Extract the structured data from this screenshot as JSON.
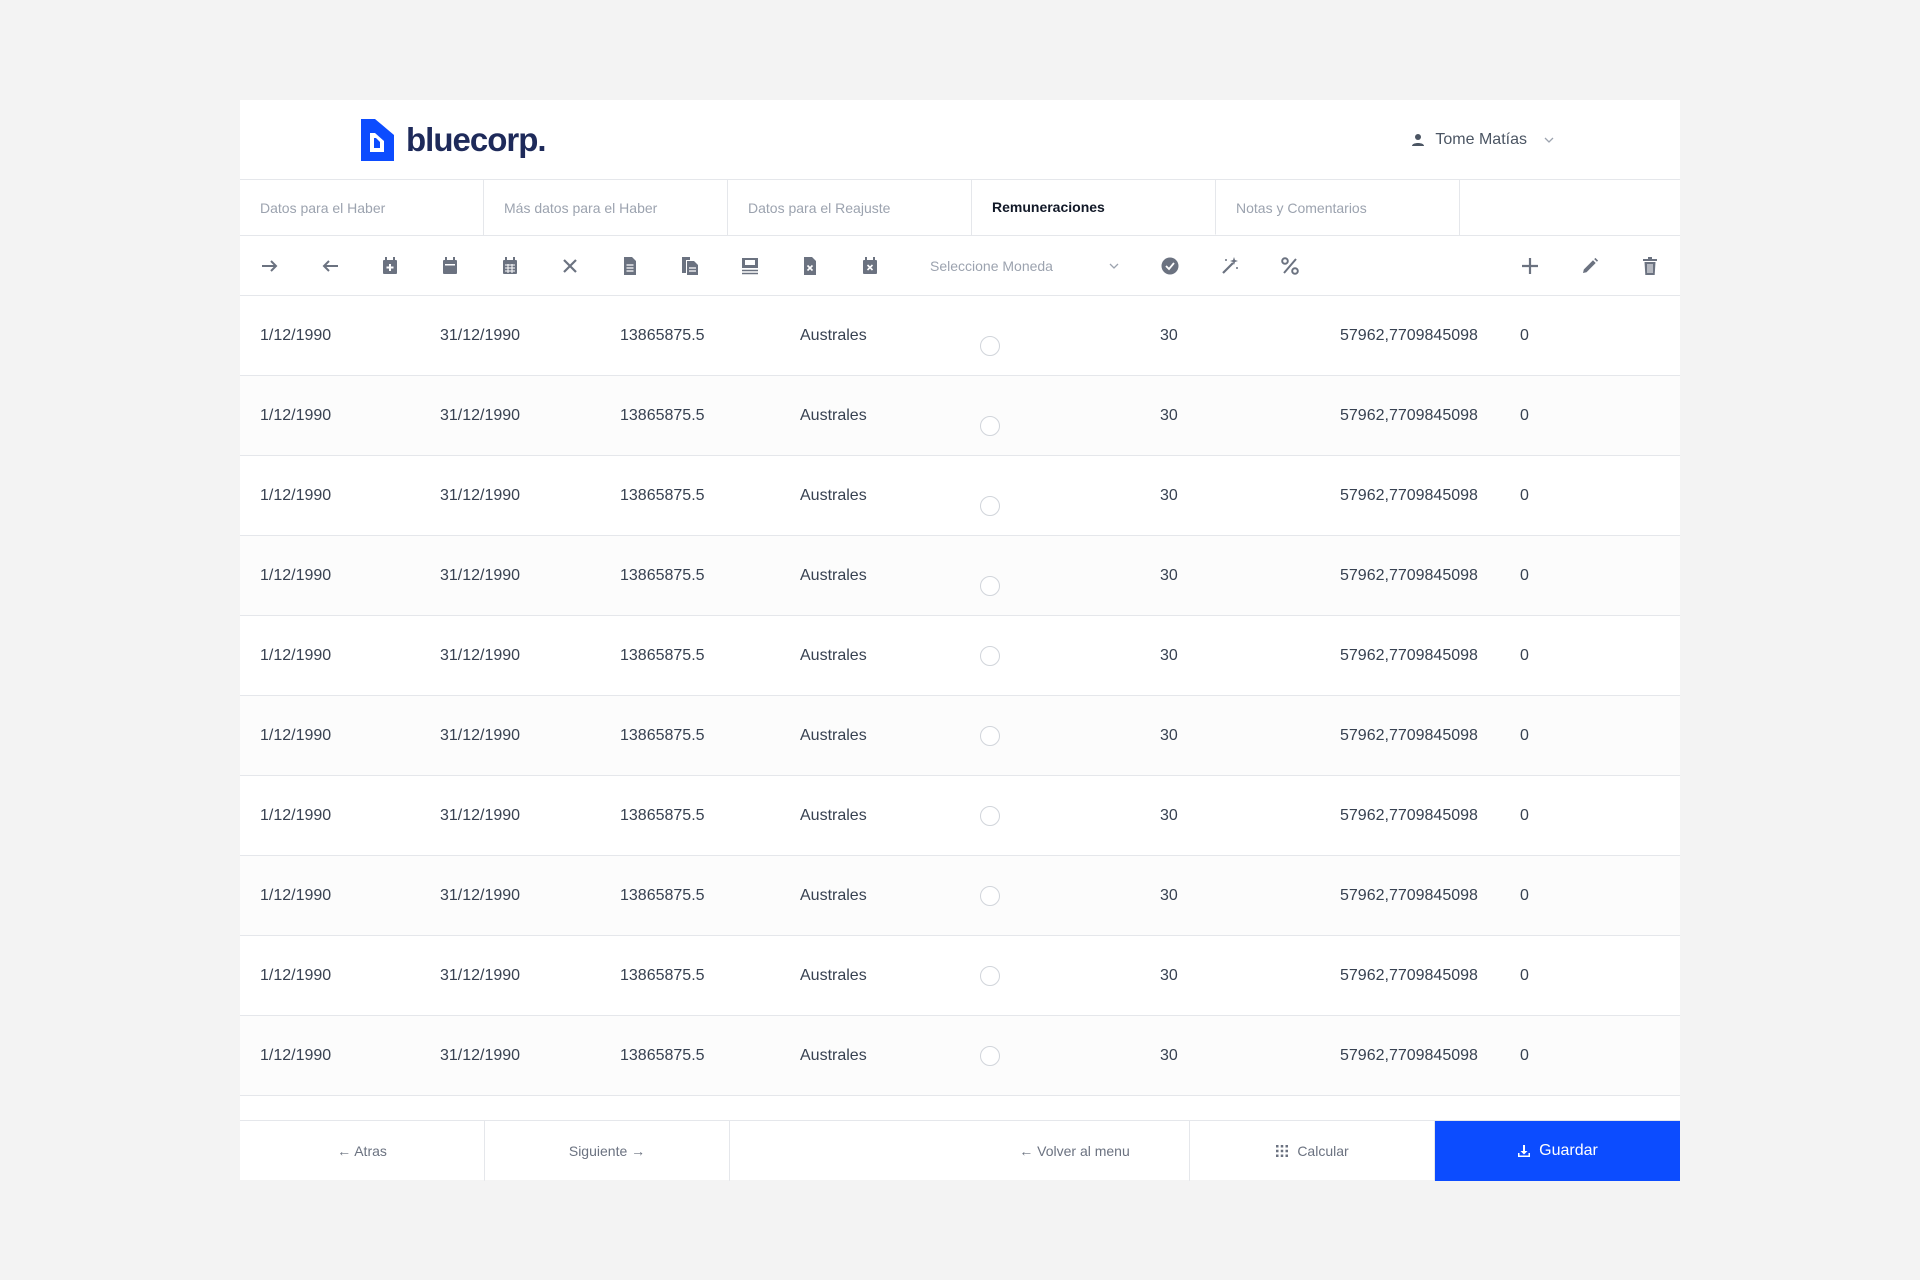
{
  "brand": {
    "name": "bluecorp.",
    "color": "#0c4cff"
  },
  "user": {
    "name": "Tome Matías",
    "icon": "person-icon"
  },
  "tabs": [
    {
      "label": "Datos para el Haber",
      "active": false
    },
    {
      "label": "Más datos para el Haber",
      "active": false
    },
    {
      "label": "Datos para el Reajuste",
      "active": false
    },
    {
      "label": "Remuneraciones",
      "active": true
    },
    {
      "label": "Notas y Comentarios",
      "active": false
    }
  ],
  "toolbar": {
    "icons": [
      "arrow-right-icon",
      "arrow-left-icon",
      "calendar-plus-icon",
      "calendar-icon",
      "calendar-grid-icon",
      "close-icon",
      "document-icon",
      "copy-document-icon",
      "image-list-icon",
      "document-remove-icon",
      "calendar-remove-icon"
    ],
    "currency_placeholder": "Seleccione Moneda",
    "right_icons": [
      "check-circle-icon",
      "magic-wand-icon",
      "percent-icon"
    ],
    "action_icons": [
      "add-icon",
      "edit-icon",
      "trash-icon"
    ]
  },
  "rows": [
    {
      "desde": "1/12/1990",
      "hasta": "31/12/1990",
      "monto": "13865875.5",
      "moneda": "Australes",
      "selected": false,
      "dias": "30",
      "valor": "57962,7709845098",
      "extra": "0"
    },
    {
      "desde": "1/12/1990",
      "hasta": "31/12/1990",
      "monto": "13865875.5",
      "moneda": "Australes",
      "selected": false,
      "dias": "30",
      "valor": "57962,7709845098",
      "extra": "0"
    },
    {
      "desde": "1/12/1990",
      "hasta": "31/12/1990",
      "monto": "13865875.5",
      "moneda": "Australes",
      "selected": false,
      "dias": "30",
      "valor": "57962,7709845098",
      "extra": "0"
    },
    {
      "desde": "1/12/1990",
      "hasta": "31/12/1990",
      "monto": "13865875.5",
      "moneda": "Australes",
      "selected": false,
      "dias": "30",
      "valor": "57962,7709845098",
      "extra": "0"
    },
    {
      "desde": "1/12/1990",
      "hasta": "31/12/1990",
      "monto": "13865875.5",
      "moneda": "Australes",
      "selected": false,
      "dias": "30",
      "valor": "57962,7709845098",
      "extra": "0"
    },
    {
      "desde": "1/12/1990",
      "hasta": "31/12/1990",
      "monto": "13865875.5",
      "moneda": "Australes",
      "selected": false,
      "dias": "30",
      "valor": "57962,7709845098",
      "extra": "0"
    },
    {
      "desde": "1/12/1990",
      "hasta": "31/12/1990",
      "monto": "13865875.5",
      "moneda": "Australes",
      "selected": false,
      "dias": "30",
      "valor": "57962,7709845098",
      "extra": "0"
    },
    {
      "desde": "1/12/1990",
      "hasta": "31/12/1990",
      "monto": "13865875.5",
      "moneda": "Australes",
      "selected": false,
      "dias": "30",
      "valor": "57962,7709845098",
      "extra": "0"
    },
    {
      "desde": "1/12/1990",
      "hasta": "31/12/1990",
      "monto": "13865875.5",
      "moneda": "Australes",
      "selected": false,
      "dias": "30",
      "valor": "57962,7709845098",
      "extra": "0"
    },
    {
      "desde": "1/12/1990",
      "hasta": "31/12/1990",
      "monto": "13865875.5",
      "moneda": "Australes",
      "selected": false,
      "dias": "30",
      "valor": "57962,7709845098",
      "extra": "0"
    }
  ],
  "footer": {
    "atras": "← Atras",
    "siguiente": "Siguiente →",
    "volver": "← Volver al menu",
    "calcular": "Calcular",
    "guardar": "Guardar"
  }
}
